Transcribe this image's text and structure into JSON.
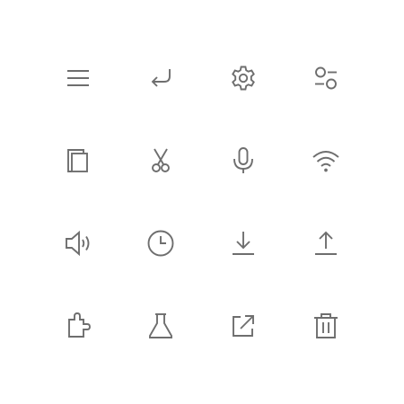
{
  "icon_color": "#6e6e6e",
  "background_color": "#ffffff",
  "icons": [
    "menu-icon",
    "undo-return-icon",
    "settings-gear-icon",
    "filter-sliders-icon",
    "copy-icon",
    "scissors-icon",
    "microphone-icon",
    "wifi-icon",
    "volume-speaker-icon",
    "clock-icon",
    "download-icon",
    "upload-icon",
    "puzzle-piece-icon",
    "flask-icon",
    "external-link-icon",
    "trash-icon"
  ]
}
